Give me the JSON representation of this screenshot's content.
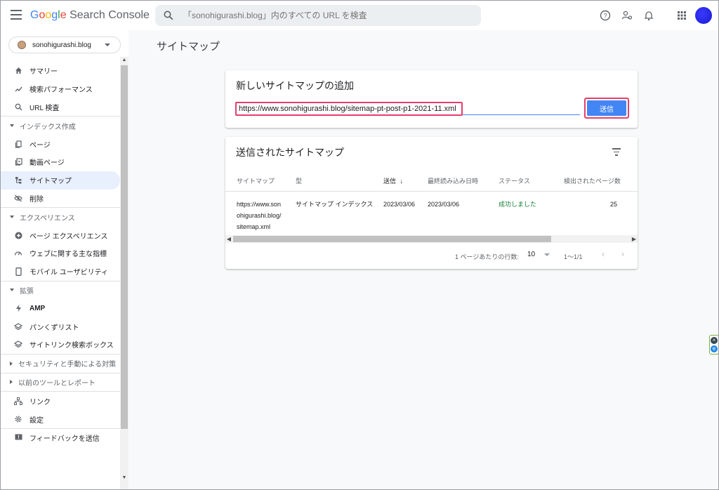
{
  "header": {
    "logo_google": "Google",
    "logo_product": "Search Console",
    "search_placeholder": "「sonohigurashi.blog」内のすべての URL を検査"
  },
  "property": {
    "name": "sonohigurashi.blog"
  },
  "sidebar": {
    "items": [
      {
        "label": "サマリー",
        "icon": "home-icon"
      },
      {
        "label": "検索パフォーマンス",
        "icon": "trending-up-icon"
      },
      {
        "label": "URL 検査",
        "icon": "search-icon"
      }
    ],
    "section_index": "インデックス作成",
    "index_items": [
      {
        "label": "ページ",
        "icon": "pages-icon"
      },
      {
        "label": "動画ページ",
        "icon": "video-page-icon"
      },
      {
        "label": "サイトマップ",
        "icon": "sitemap-icon",
        "active": true
      },
      {
        "label": "削除",
        "icon": "visibility-off-icon"
      }
    ],
    "section_experience": "エクスペリエンス",
    "experience_items": [
      {
        "label": "ページ エクスペリエンス",
        "icon": "plus-circle-icon"
      },
      {
        "label": "ウェブに関する主な指標",
        "icon": "speed-icon"
      },
      {
        "label": "モバイル ユーザビリティ",
        "icon": "phone-icon"
      }
    ],
    "section_enhancements": "拡張",
    "enhancement_items": [
      {
        "label": "AMP",
        "icon": "bolt-icon"
      },
      {
        "label": "パンくずリスト",
        "icon": "layers-icon"
      },
      {
        "label": "サイトリンク検索ボックス",
        "icon": "layers-icon"
      }
    ],
    "section_security": "セキュリティと手動による対策",
    "section_legacy": "以前のツールとレポート",
    "bottom_items": [
      {
        "label": "リンク",
        "icon": "links-icon"
      },
      {
        "label": "設定",
        "icon": "gear-icon"
      }
    ],
    "feedback": "フィードバックを送信"
  },
  "main": {
    "page_title": "サイトマップ",
    "add_card": {
      "title": "新しいサイトマップの追加",
      "url_value": "https://www.sonohigurashi.blog/sitemap-pt-post-p1-2021-11.xml",
      "submit_label": "送信"
    },
    "submitted_card": {
      "title": "送信されたサイトマップ",
      "columns": [
        "サイトマップ",
        "型",
        "送信",
        "最終読み込み日時",
        "ステータス",
        "検出されたページ数"
      ],
      "sort_arrow": "↓",
      "rows": [
        {
          "sitemap_line1": "https://www.son",
          "sitemap_line2": "ohigurashi.blog/",
          "sitemap_line3": "sitemap.xml",
          "type": "サイトマップ インデックス",
          "submitted": "2023/03/06",
          "last_read": "2023/03/06",
          "status": "成功しました",
          "pages": "25"
        }
      ],
      "rows_per_page_label": "1 ページあたりの行数:",
      "rows_per_page": "10",
      "range": "1〜1/1"
    }
  },
  "colors": {
    "accent": "#4285f4",
    "highlight": "#e53e6b",
    "success": "#188038"
  }
}
